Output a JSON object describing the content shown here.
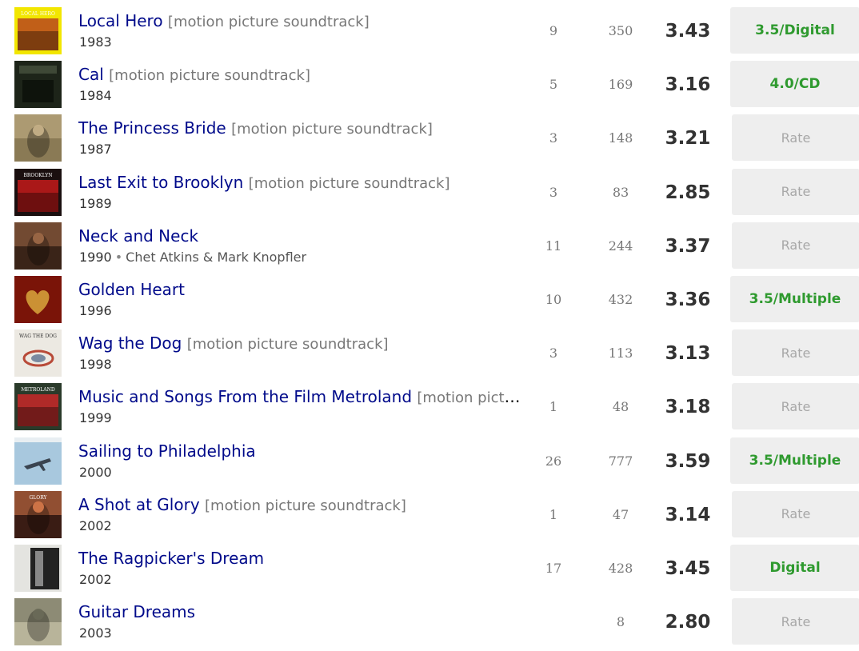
{
  "rows": [
    {
      "title": "Local Hero",
      "subtitle": "[motion picture soundtrack]",
      "year": "1983",
      "artist": "",
      "reviews": "9",
      "ratings": "350",
      "average": "3.43",
      "user_rating": "3.5/Digital",
      "rated": true,
      "cover": {
        "bg": "#f2e600",
        "accent": "#b8461c",
        "text": "LOCAL HERO",
        "style": "band"
      }
    },
    {
      "title": "Cal",
      "subtitle": "[motion picture soundtrack]",
      "year": "1984",
      "artist": "",
      "reviews": "5",
      "ratings": "169",
      "average": "3.16",
      "user_rating": "4.0/CD",
      "rated": true,
      "cover": {
        "bg": "#1d2419",
        "accent": "#55604a",
        "text": "",
        "style": "dark"
      }
    },
    {
      "title": "The Princess Bride",
      "subtitle": "[motion picture soundtrack]",
      "year": "1987",
      "artist": "",
      "reviews": "3",
      "ratings": "148",
      "average": "3.21",
      "user_rating": "Rate",
      "rated": false,
      "cover": {
        "bg": "#8a7a55",
        "accent": "#c9b48a",
        "text": "",
        "style": "photo"
      }
    },
    {
      "title": "Last Exit to Brooklyn",
      "subtitle": "[motion picture soundtrack]",
      "year": "1989",
      "artist": "",
      "reviews": "3",
      "ratings": "83",
      "average": "2.85",
      "user_rating": "Rate",
      "rated": false,
      "cover": {
        "bg": "#1a0f0f",
        "accent": "#c41a1a",
        "text": "BROOKLYN",
        "style": "band"
      }
    },
    {
      "title": "Neck and Neck",
      "subtitle": "",
      "year": "1990",
      "artist": "Chet Atkins & Mark Knopfler",
      "reviews": "11",
      "ratings": "244",
      "average": "3.37",
      "user_rating": "Rate",
      "rated": false,
      "cover": {
        "bg": "#3a2418",
        "accent": "#a06a48",
        "text": "",
        "style": "photo"
      }
    },
    {
      "title": "Golden Heart",
      "subtitle": "",
      "year": "1996",
      "artist": "",
      "reviews": "10",
      "ratings": "432",
      "average": "3.36",
      "user_rating": "3.5/Multiple",
      "rated": true,
      "cover": {
        "bg": "#7a1408",
        "accent": "#e0b040",
        "text": "",
        "style": "heart"
      }
    },
    {
      "title": "Wag the Dog",
      "subtitle": "[motion picture soundtrack]",
      "year": "1998",
      "artist": "",
      "reviews": "3",
      "ratings": "113",
      "average": "3.13",
      "user_rating": "Rate",
      "rated": false,
      "cover": {
        "bg": "#ece9e2",
        "accent": "#b84a38",
        "text": "WAG THE DOG",
        "style": "light"
      }
    },
    {
      "title": "Music and Songs From the Film Metroland",
      "subtitle": "[motion picture soundtrack]",
      "year": "1999",
      "artist": "",
      "reviews": "1",
      "ratings": "48",
      "average": "3.18",
      "user_rating": "Rate",
      "rated": false,
      "cover": {
        "bg": "#2a3a2a",
        "accent": "#c82828",
        "text": "METROLAND",
        "style": "band"
      }
    },
    {
      "title": "Sailing to Philadelphia",
      "subtitle": "",
      "year": "2000",
      "artist": "",
      "reviews": "26",
      "ratings": "777",
      "average": "3.59",
      "user_rating": "3.5/Multiple",
      "rated": true,
      "cover": {
        "bg": "#a8c8de",
        "accent": "#3a4450",
        "text": "",
        "style": "sky"
      }
    },
    {
      "title": "A Shot at Glory",
      "subtitle": "[motion picture soundtrack]",
      "year": "2002",
      "artist": "",
      "reviews": "1",
      "ratings": "47",
      "average": "3.14",
      "user_rating": "Rate",
      "rated": false,
      "cover": {
        "bg": "#3a1c14",
        "accent": "#d87a4a",
        "text": "GLORY",
        "style": "photo"
      }
    },
    {
      "title": "The Ragpicker's Dream",
      "subtitle": "",
      "year": "2002",
      "artist": "",
      "reviews": "17",
      "ratings": "428",
      "average": "3.45",
      "user_rating": "Digital",
      "rated": true,
      "cover": {
        "bg": "#e4e4e0",
        "accent": "#333333",
        "text": "",
        "style": "bw"
      }
    },
    {
      "title": "Guitar Dreams",
      "subtitle": "",
      "year": "2003",
      "artist": "",
      "reviews": "",
      "ratings": "8",
      "average": "2.80",
      "user_rating": "Rate",
      "rated": false,
      "cover": {
        "bg": "#b8b49a",
        "accent": "#6a6a58",
        "text": "",
        "style": "photo"
      }
    }
  ]
}
